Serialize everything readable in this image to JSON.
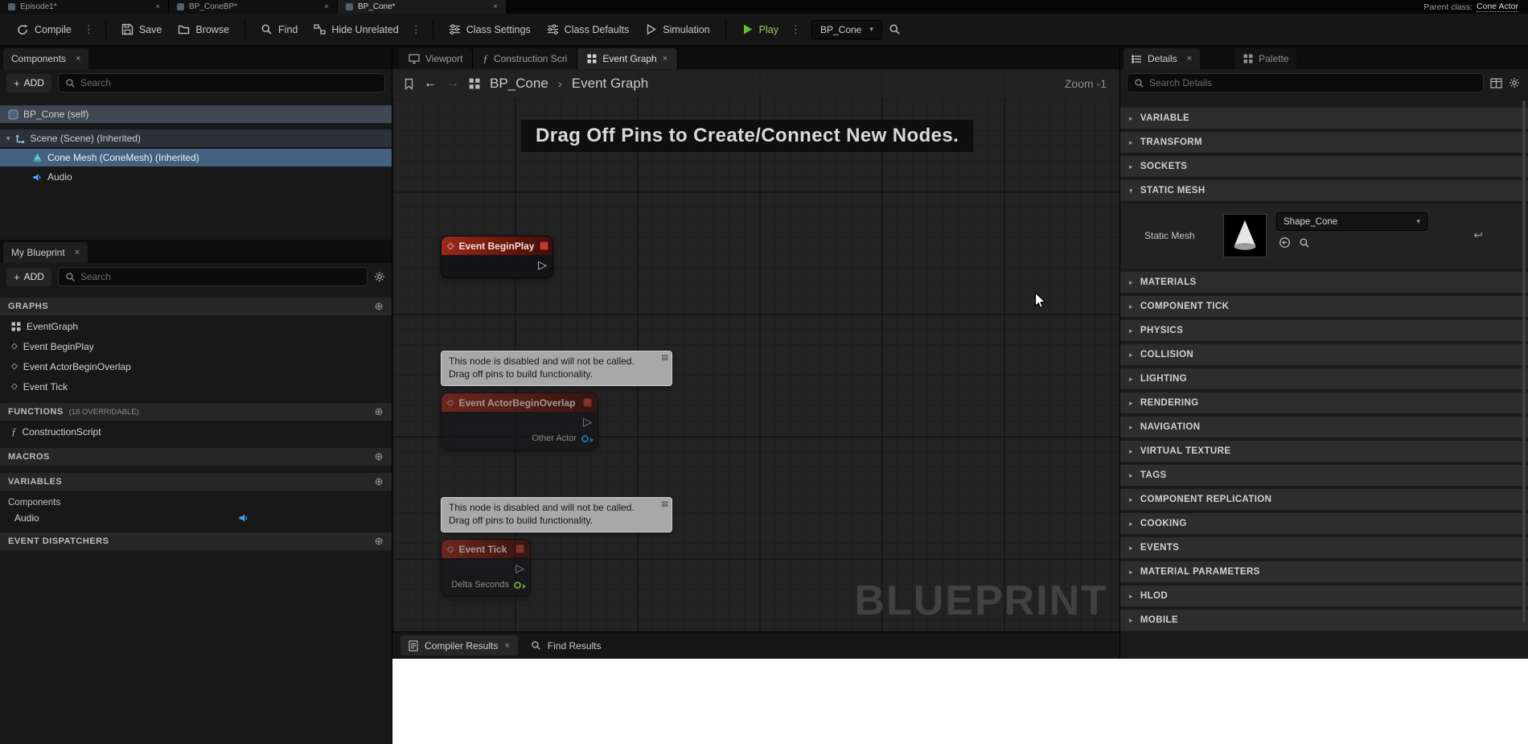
{
  "colors": {
    "play_green": "#5fc327",
    "selection_blue": "#44627f",
    "node_header_red": "#9a2a1d",
    "pin_blue": "#2e9fe6",
    "pin_green": "#97e356"
  },
  "top_bar": {
    "tabs": [
      {
        "label": "Episode1*"
      },
      {
        "label": "BP_ConeBP*"
      },
      {
        "label": "BP_Cone*"
      }
    ],
    "parent_class_label": "Parent class:",
    "parent_class_value": "Cone Actor"
  },
  "toolbar": {
    "compile": "Compile",
    "save": "Save",
    "browse": "Browse",
    "find": "Find",
    "hide_unrelated": "Hide Unrelated",
    "class_settings": "Class Settings",
    "class_defaults": "Class Defaults",
    "simulation": "Simulation",
    "play": "Play",
    "debug_target": "BP_Cone"
  },
  "components_panel": {
    "tab": "Components",
    "add": "ADD",
    "search_placeholder": "Search",
    "rows": [
      {
        "label": "BP_Cone (self)"
      },
      {
        "label": "Scene (Scene) (Inherited)"
      },
      {
        "label": "Cone Mesh (ConeMesh) (Inherited)"
      },
      {
        "label": "Audio"
      }
    ]
  },
  "my_blueprint_panel": {
    "tab": "My Blueprint",
    "add": "ADD",
    "search_placeholder": "Search",
    "graphs": {
      "header": "GRAPHS",
      "items": [
        "EventGraph",
        "Event BeginPlay",
        "Event ActorBeginOverlap",
        "Event Tick"
      ]
    },
    "functions": {
      "header": "FUNCTIONS",
      "badge": "(18 OVERRIDABLE)",
      "items": [
        "ConstructionScript"
      ]
    },
    "macros": {
      "header": "MACROS"
    },
    "variables": {
      "header": "VARIABLES",
      "category": "Components",
      "items": [
        "Audio"
      ]
    },
    "event_dispatchers": {
      "header": "EVENT DISPATCHERS"
    }
  },
  "graph_area": {
    "tabs": [
      {
        "label": "Viewport"
      },
      {
        "label": "Construction Scri"
      },
      {
        "label": "Event Graph"
      }
    ],
    "breadcrumb": {
      "root": "BP_Cone",
      "current": "Event Graph"
    },
    "zoom": "Zoom -1",
    "banner": "Drag Off Pins to Create/Connect New Nodes.",
    "watermark": "BLUEPRINT",
    "disabled_note": {
      "line1": "This node is disabled and will not be called.",
      "line2": "Drag off pins to build functionality."
    },
    "nodes": {
      "begin_play": {
        "title": "Event BeginPlay"
      },
      "actor_begin_overlap": {
        "title": "Event ActorBeginOverlap",
        "pin_label": "Other Actor"
      },
      "tick": {
        "title": "Event Tick",
        "pin_label": "Delta Seconds"
      }
    },
    "bottom_bar": {
      "compiler_results": "Compiler Results",
      "find_results": "Find Results"
    }
  },
  "details_panel": {
    "tab": "Details",
    "palette_tab": "Palette",
    "search_placeholder": "Search Details",
    "sections": [
      "VARIABLE",
      "TRANSFORM",
      "SOCKETS",
      "STATIC MESH",
      "MATERIALS",
      "COMPONENT TICK",
      "PHYSICS",
      "COLLISION",
      "LIGHTING",
      "RENDERING",
      "NAVIGATION",
      "VIRTUAL TEXTURE",
      "TAGS",
      "COMPONENT REPLICATION",
      "COOKING",
      "EVENTS",
      "MATERIAL PARAMETERS",
      "HLOD",
      "MOBILE"
    ],
    "static_mesh_row": {
      "label": "Static Mesh",
      "value": "Shape_Cone"
    }
  }
}
